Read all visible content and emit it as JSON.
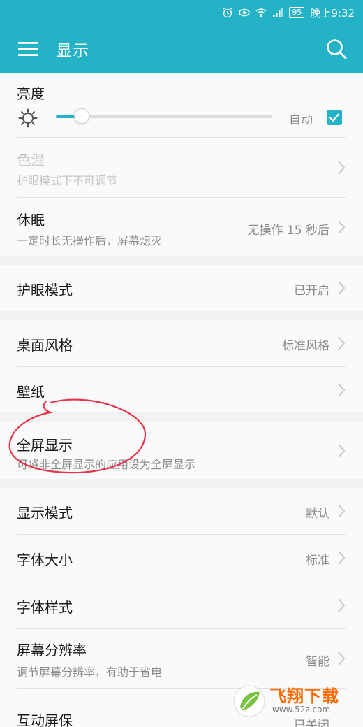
{
  "status_bar": {
    "battery": "95",
    "time": "晚上9:32",
    "network": "4G"
  },
  "app_bar": {
    "title": "显示",
    "icons": [
      "menu-icon",
      "search-icon"
    ]
  },
  "brightness": {
    "title": "亮度",
    "auto_label": "自动",
    "auto_checked": true,
    "level": 0.12
  },
  "items": {
    "color_temp": {
      "title": "色温",
      "subtitle": "护眼模式下不可调节",
      "enabled": false
    },
    "sleep": {
      "title": "休眠",
      "subtitle": "一定时长无操作后，屏幕熄灭",
      "value": "无操作 15 秒后"
    },
    "eye_comfort": {
      "title": "护眼模式",
      "value": "已开启"
    },
    "desktop_style": {
      "title": "桌面风格",
      "value": "标准风格"
    },
    "wallpaper": {
      "title": "壁纸"
    },
    "fullscreen": {
      "title": "全屏显示",
      "subtitle": "可将非全屏显示的应用设为全屏显示"
    },
    "display_mode": {
      "title": "显示模式",
      "value": "默认"
    },
    "font_size": {
      "title": "字体大小",
      "value": "标准"
    },
    "font_style": {
      "title": "字体样式"
    },
    "resolution": {
      "title": "屏幕分辨率",
      "subtitle": "调节屏幕分辨率，有助于省电",
      "value": "智能"
    },
    "interactive": {
      "title": "互动屏保",
      "value": "已关闭"
    }
  },
  "watermark": {
    "brand": "飞翔下载",
    "url": "www.52z.com"
  },
  "colors": {
    "accent": "#24b3c6",
    "annotation": "#e8344a"
  }
}
